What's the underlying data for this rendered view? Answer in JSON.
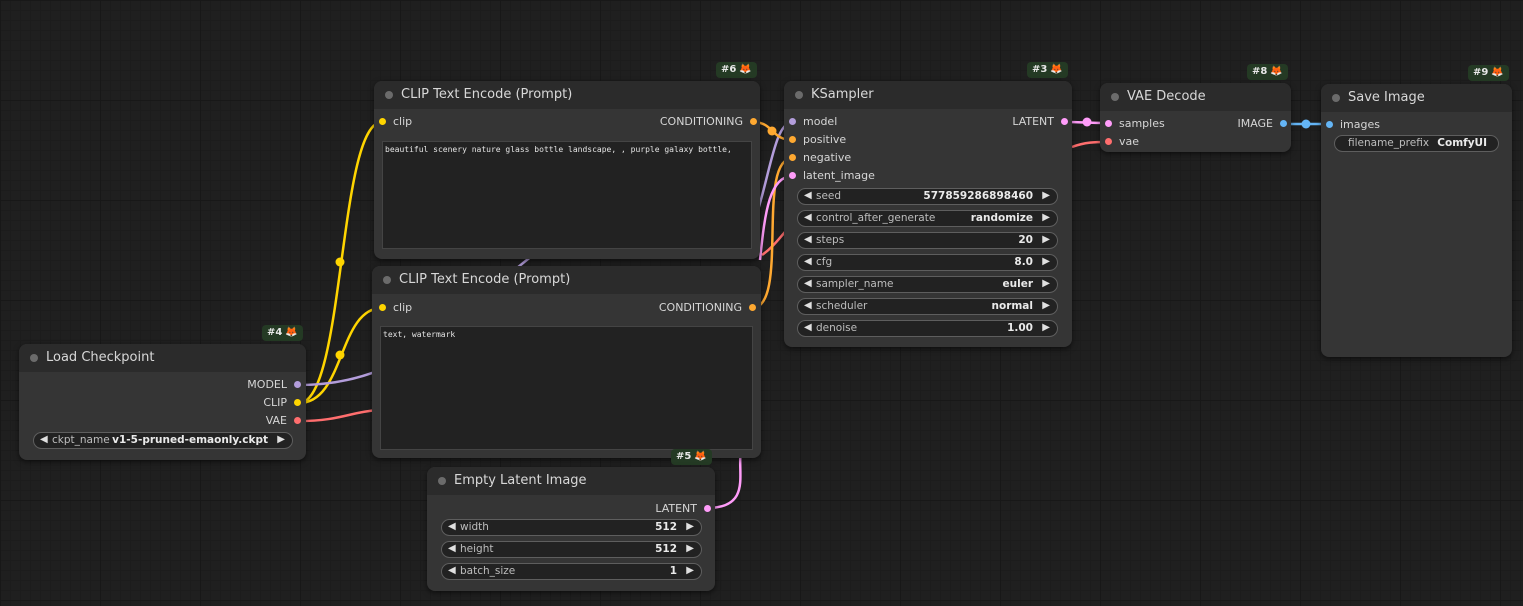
{
  "colors": {
    "MODEL": "#b39ddb",
    "CLIP": "#ffd500",
    "VAE": "#ff6e6e",
    "CONDITIONING": "#ffa931",
    "LATENT": "#ff9cf9",
    "IMAGE": "#64b5f6"
  },
  "nodes": {
    "load_checkpoint": {
      "id": "#4",
      "title": "Load Checkpoint",
      "outputs": [
        "MODEL",
        "CLIP",
        "VAE"
      ],
      "ckpt_name": {
        "label": "ckpt_name",
        "value": "v1-5-pruned-emaonly.ckpt"
      }
    },
    "clip_pos": {
      "id": "#6",
      "title": "CLIP Text Encode (Prompt)",
      "input": "clip",
      "output": "CONDITIONING",
      "text": "beautiful scenery nature glass bottle landscape, , purple galaxy bottle,"
    },
    "clip_neg": {
      "id": "#7",
      "title": "CLIP Text Encode (Prompt)",
      "input": "clip",
      "output": "CONDITIONING",
      "text": "text, watermark"
    },
    "empty_latent": {
      "id": "#5",
      "title": "Empty Latent Image",
      "output": "LATENT",
      "widgets": [
        {
          "label": "width",
          "value": "512"
        },
        {
          "label": "height",
          "value": "512"
        },
        {
          "label": "batch_size",
          "value": "1"
        }
      ]
    },
    "ksampler": {
      "id": "#3",
      "title": "KSampler",
      "inputs": [
        "model",
        "positive",
        "negative",
        "latent_image"
      ],
      "output": "LATENT",
      "widgets": [
        {
          "label": "seed",
          "value": "577859286898460"
        },
        {
          "label": "control_after_generate",
          "value": "randomize"
        },
        {
          "label": "steps",
          "value": "20"
        },
        {
          "label": "cfg",
          "value": "8.0"
        },
        {
          "label": "sampler_name",
          "value": "euler"
        },
        {
          "label": "scheduler",
          "value": "normal"
        },
        {
          "label": "denoise",
          "value": "1.00"
        }
      ]
    },
    "vae_decode": {
      "id": "#8",
      "title": "VAE Decode",
      "inputs": [
        "samples",
        "vae"
      ],
      "output": "IMAGE"
    },
    "save_image": {
      "id": "#9",
      "title": "Save Image",
      "input": "images",
      "filename_prefix": {
        "label": "filename_prefix",
        "value": "ComfyUI"
      }
    }
  },
  "icons": {
    "node_badge": "fox-icon",
    "arrow_left": "left-arrow-icon",
    "arrow_right": "right-arrow-icon"
  }
}
